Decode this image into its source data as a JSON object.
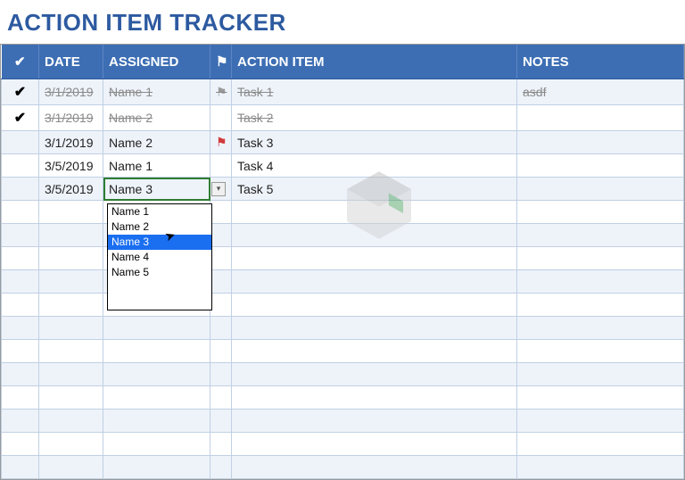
{
  "title": "ACTION ITEM TRACKER",
  "columns": {
    "check": "✔",
    "date": "DATE",
    "assigned": "ASSIGNED",
    "flag": "⚑",
    "action_item": "ACTION ITEM",
    "notes": "NOTES"
  },
  "rows": [
    {
      "done": true,
      "date": "3/1/2019",
      "assigned": "Name 1",
      "flag": "gray",
      "item": "Task 1",
      "notes": "asdf"
    },
    {
      "done": true,
      "date": "3/1/2019",
      "assigned": "Name 2",
      "flag": "",
      "item": "Task 2",
      "notes": ""
    },
    {
      "done": false,
      "date": "3/1/2019",
      "assigned": "Name 2",
      "flag": "red",
      "item": "Task 3",
      "notes": ""
    },
    {
      "done": false,
      "date": "3/5/2019",
      "assigned": "Name 1",
      "flag": "",
      "item": "Task 4",
      "notes": ""
    },
    {
      "done": false,
      "date": "3/5/2019",
      "assigned": "Name 3",
      "flag": "",
      "item": "Task 5",
      "notes": "",
      "editing": true
    }
  ],
  "empty_rows": 12,
  "dropdown": {
    "options": [
      "Name 1",
      "Name 2",
      "Name 3",
      "Name 4",
      "Name 5"
    ],
    "highlighted_index": 2
  },
  "icons": {
    "check": "✔",
    "flag": "⚑",
    "dd_arrow": "▾",
    "cursor": "↖"
  }
}
